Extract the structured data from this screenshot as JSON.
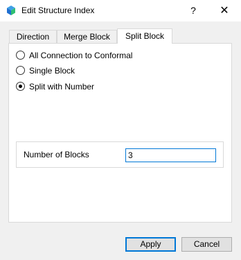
{
  "window": {
    "title": "Edit Structure Index",
    "help_label": "?",
    "close_label": "✕"
  },
  "tabs": [
    {
      "label": "Direction",
      "active": false
    },
    {
      "label": "Merge Block",
      "active": false
    },
    {
      "label": "Split Block",
      "active": true
    }
  ],
  "options": [
    {
      "label": "All Connection to Conformal",
      "selected": false
    },
    {
      "label": "Single Block",
      "selected": false
    },
    {
      "label": "Split with Number",
      "selected": true
    }
  ],
  "number_of_blocks": {
    "label": "Number of Blocks",
    "value": "3"
  },
  "buttons": {
    "apply": "Apply",
    "cancel": "Cancel"
  },
  "colors": {
    "accent": "#0078d7",
    "icon_blue": "#1f6fd1",
    "icon_green": "#2fbf71"
  }
}
